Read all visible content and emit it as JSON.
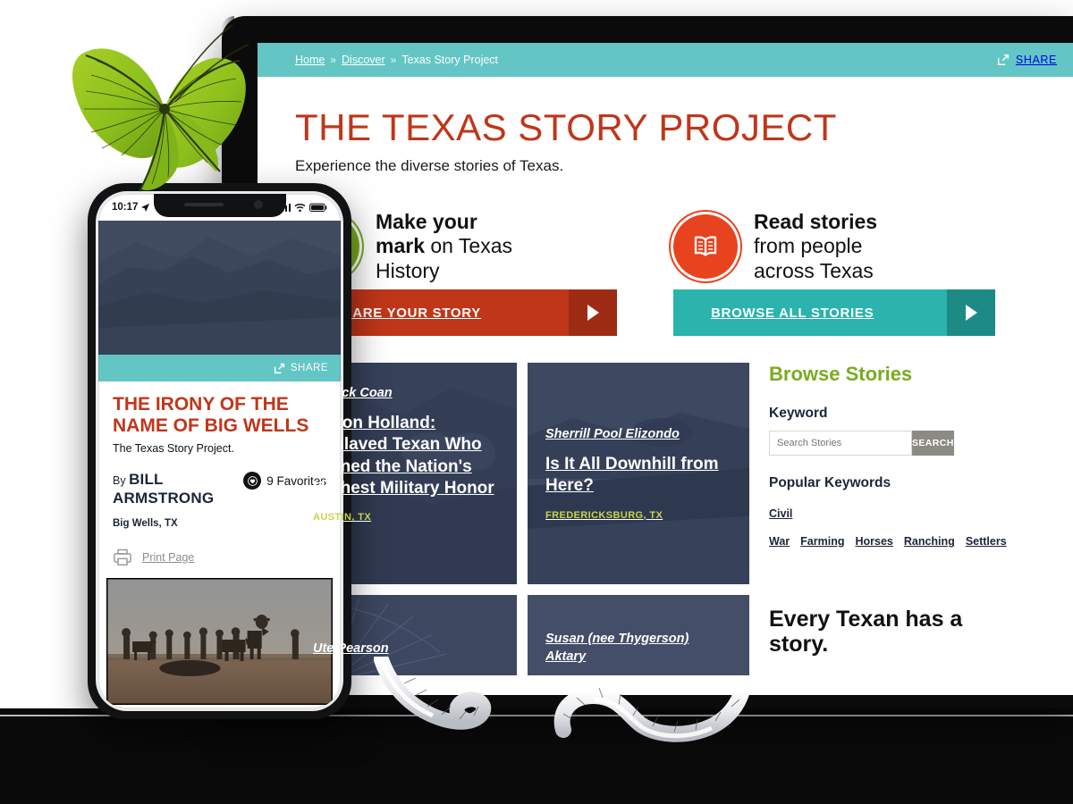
{
  "tablet": {
    "breadcrumb": {
      "home": "Home",
      "discover": "Discover",
      "current": "Texas Story Project",
      "separator": "»"
    },
    "share_label": "SHARE",
    "hero": {
      "title": "THE TEXAS STORY PROJECT",
      "subtitle": "Experience the diverse stories of Texas."
    },
    "cta": [
      {
        "icon": "speech-bubble-plus-icon",
        "line1": "Make your",
        "line2_bold": "mark",
        "line2_rest": " on Texas",
        "line3": "History",
        "button": "SHARE YOUR STORY",
        "color": "#c0361a",
        "circle_color": "#7aab1f"
      },
      {
        "icon": "open-book-icon",
        "line1": "Read stories",
        "line2_bold": "",
        "line2_rest": "from people",
        "line3": "across Texas",
        "button": "BROWSE ALL STORIES",
        "color": "#2bb3ad",
        "circle_color": "#e8431f"
      }
    ],
    "cards": [
      {
        "author": "Patrick Coan",
        "title": "Milton Holland: Enslaved Texan Who Earned the Nation's Highest Military Honor",
        "location": "AUSTIN, TX"
      },
      {
        "author": "Sherrill Pool Elizondo",
        "title": "Is It All Downhill from Here?",
        "location": "FREDERICKSBURG, TX"
      },
      {
        "author": "Ute Pearson",
        "title": "",
        "location": ""
      },
      {
        "author": "Susan (nee Thygerson) Aktary",
        "title": "",
        "location": ""
      }
    ],
    "sidebar": {
      "heading": "Browse Stories",
      "keyword_label": "Keyword",
      "search_placeholder": "Search Stories",
      "search_value": "",
      "search_button": "SEARCH",
      "popular_label": "Popular Keywords",
      "keywords": [
        "Civil War",
        "Farming",
        "Horses",
        "Ranching",
        "Settlers"
      ],
      "tagline": "Every Texan has a story."
    }
  },
  "phone": {
    "status": {
      "time": "10:17",
      "location_icon": "location-arrow-icon",
      "signal_icon": "cellular-signal-icon",
      "wifi_icon": "wifi-icon",
      "battery_icon": "battery-icon"
    },
    "share_label": "SHARE",
    "article": {
      "title": "THE IRONY OF THE NAME OF BIG WELLS",
      "subtitle": "The Texas Story Project.",
      "by_prefix": "By",
      "author": "BILL ARMSTRONG",
      "favorites": "9 Favorites",
      "location": "Big Wells, TX",
      "print_label": "Print Page"
    }
  },
  "decor": {
    "leaf": "green-leaf-illustration",
    "snake": "white-snake-illustration"
  },
  "colors": {
    "teal": "#63c6c5",
    "teal_button": "#2bb3ad",
    "red": "#c0361a",
    "green": "#7aab1f",
    "orange": "#e8431f",
    "card_navy": "#3c4761"
  }
}
